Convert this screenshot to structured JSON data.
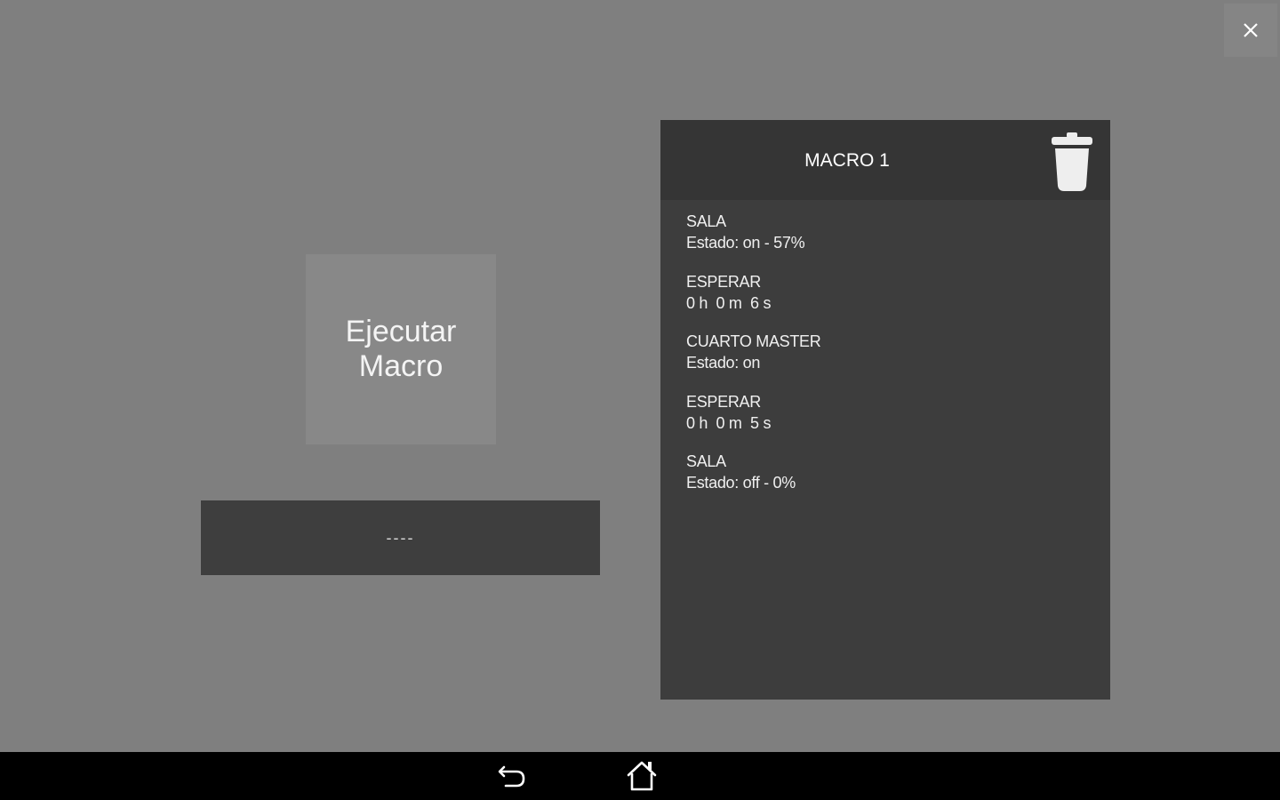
{
  "close": {
    "icon": "close-icon"
  },
  "run_button": {
    "label": "Ejecutar Macro"
  },
  "status": {
    "text": "----"
  },
  "macro_panel": {
    "title": "MACRO 1",
    "delete_icon": "trash-icon",
    "steps": [
      {
        "name": "SALA",
        "detail": "Estado: on - 57%"
      },
      {
        "name": "ESPERAR",
        "detail": "0 h  0 m  6 s"
      },
      {
        "name": "CUARTO MASTER",
        "detail": "Estado: on"
      },
      {
        "name": "ESPERAR",
        "detail": "0 h  0 m  5 s"
      },
      {
        "name": "SALA",
        "detail": "Estado: off - 0%"
      }
    ]
  },
  "nav_bar": {
    "back_icon": "back-arrow-icon",
    "home_icon": "home-icon"
  },
  "colors": {
    "background": "#7f7f7f",
    "panel": "#3d3d3d",
    "panel_header": "#353535",
    "button": "#888888",
    "nav_bar": "#000000"
  }
}
